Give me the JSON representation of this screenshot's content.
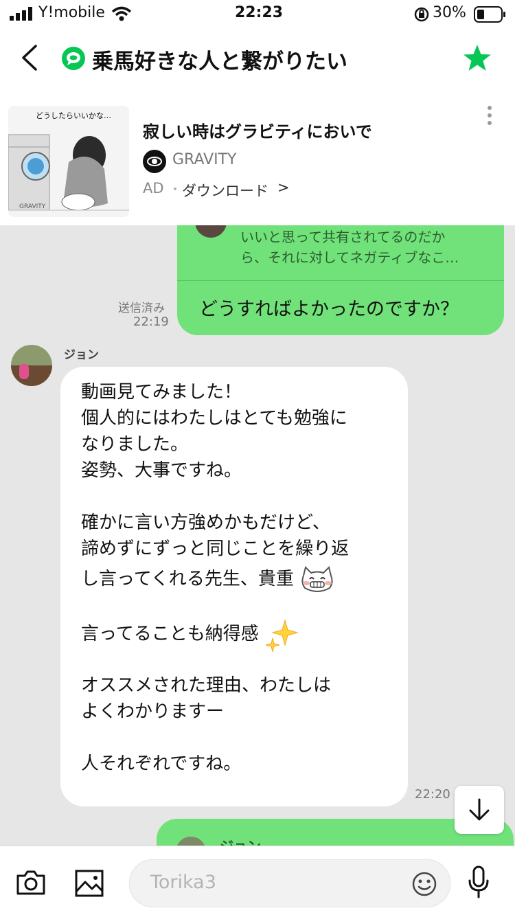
{
  "status_bar": {
    "carrier": "Y!mobile",
    "time": "22:23",
    "battery": "30%"
  },
  "header": {
    "title": "乗馬好きな人と繋がりたい"
  },
  "ad": {
    "image_caption": "どうしたらいいかな…",
    "image_logo": "GRAVITY",
    "headline": "寂しい時はグラビティにおいで",
    "advertiser": "GRAVITY",
    "label": "AD",
    "separator": "・",
    "cta": "ダウンロード",
    "cta_arrow": ">"
  },
  "chat": {
    "quoted_message": {
      "lines": [
        "いいと思って共有されてるのだか",
        "ら、それに対してネガティブなこ…"
      ]
    },
    "sent_message": {
      "text": "どうすればよかったのですか？",
      "status": "送信済み",
      "time": "22:19"
    },
    "received_message": {
      "sender": "ジョン",
      "lines": [
        "動画見てみました！",
        "個人的にはわたしはとても勉強に",
        "なりました。",
        "姿勢、大事ですね。",
        "",
        "確かに言い方強めかもだけど、",
        "諦めずにずっと同じことを繰り返",
        "し言ってくれる先生、貴重",
        "",
        "言ってることも納得感",
        "",
        "オススメされた理由、わたしは",
        "よくわかりますー",
        "",
        "人それぞれですね。"
      ],
      "time": "22:20"
    },
    "next_reply_preview": {
      "sender": "ジョン"
    }
  },
  "input": {
    "placeholder": "Torika3"
  },
  "colors": {
    "accent_green": "#06c755",
    "bubble_green": "#71e27a",
    "chat_bg": "#e6e6e6"
  },
  "icons": [
    "signal-icon",
    "wifi-icon",
    "lock-rotation-icon",
    "battery-icon",
    "back-chevron-icon",
    "openchat-icon",
    "star-icon",
    "more-vertical-icon",
    "chevron-right-icon",
    "scroll-down-icon",
    "camera-icon",
    "image-icon",
    "emoji-icon",
    "mic-icon"
  ]
}
